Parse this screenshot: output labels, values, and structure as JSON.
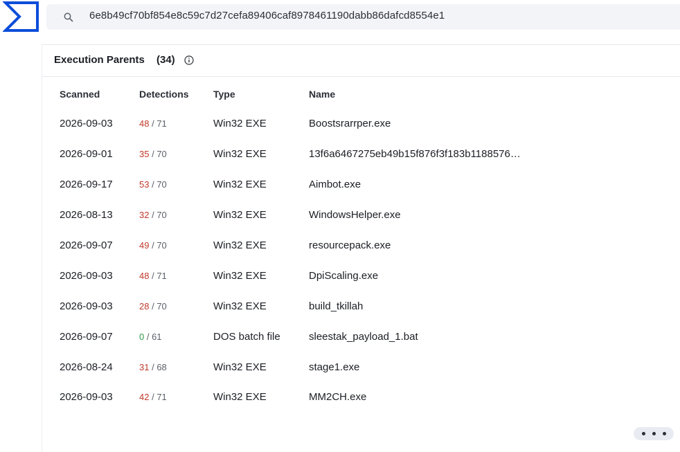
{
  "search": {
    "value": "6e8b49cf70bf854e8c59c7d27cefa89406caf8978461190dabb86dafcd8554e1"
  },
  "panel": {
    "title": "Execution Parents",
    "count": "(34)"
  },
  "table": {
    "headers": [
      "Scanned",
      "Detections",
      "Type",
      "Name"
    ],
    "rows": [
      {
        "scanned": "2026-09-03",
        "det": "48",
        "total": "71",
        "type": "Win32 EXE",
        "name": "Boostsrarrper.exe"
      },
      {
        "scanned": "2026-09-01",
        "det": "35",
        "total": "70",
        "type": "Win32 EXE",
        "name": "13f6a6467275eb49b15f876f3f183b1188576…"
      },
      {
        "scanned": "2026-09-17",
        "det": "53",
        "total": "70",
        "type": "Win32 EXE",
        "name": "Aimbot.exe"
      },
      {
        "scanned": "2026-08-13",
        "det": "32",
        "total": "70",
        "type": "Win32 EXE",
        "name": "WindowsHelper.exe"
      },
      {
        "scanned": "2026-09-07",
        "det": "49",
        "total": "70",
        "type": "Win32 EXE",
        "name": "resourcepack.exe"
      },
      {
        "scanned": "2026-09-03",
        "det": "48",
        "total": "71",
        "type": "Win32 EXE",
        "name": "DpiScaling.exe"
      },
      {
        "scanned": "2026-09-03",
        "det": "28",
        "total": "70",
        "type": "Win32 EXE",
        "name": "build_tkillah"
      },
      {
        "scanned": "2026-09-07",
        "det": "0",
        "total": "61",
        "type": "DOS batch file",
        "name": "sleestak_payload_1.bat"
      },
      {
        "scanned": "2026-08-24",
        "det": "31",
        "total": "68",
        "type": "Win32 EXE",
        "name": "stage1.exe"
      },
      {
        "scanned": "2026-09-03",
        "det": "42",
        "total": "71",
        "type": "Win32 EXE",
        "name": "MM2CH.exe"
      }
    ]
  },
  "colors": {
    "brand": "#0b4dda",
    "detection_positive": "#c0392b",
    "detection_zero": "#2e9a48"
  },
  "icons": {
    "logo": "sigma-logo",
    "search": "search-icon",
    "info": "info-icon",
    "more": "more-horizontal-icon"
  }
}
